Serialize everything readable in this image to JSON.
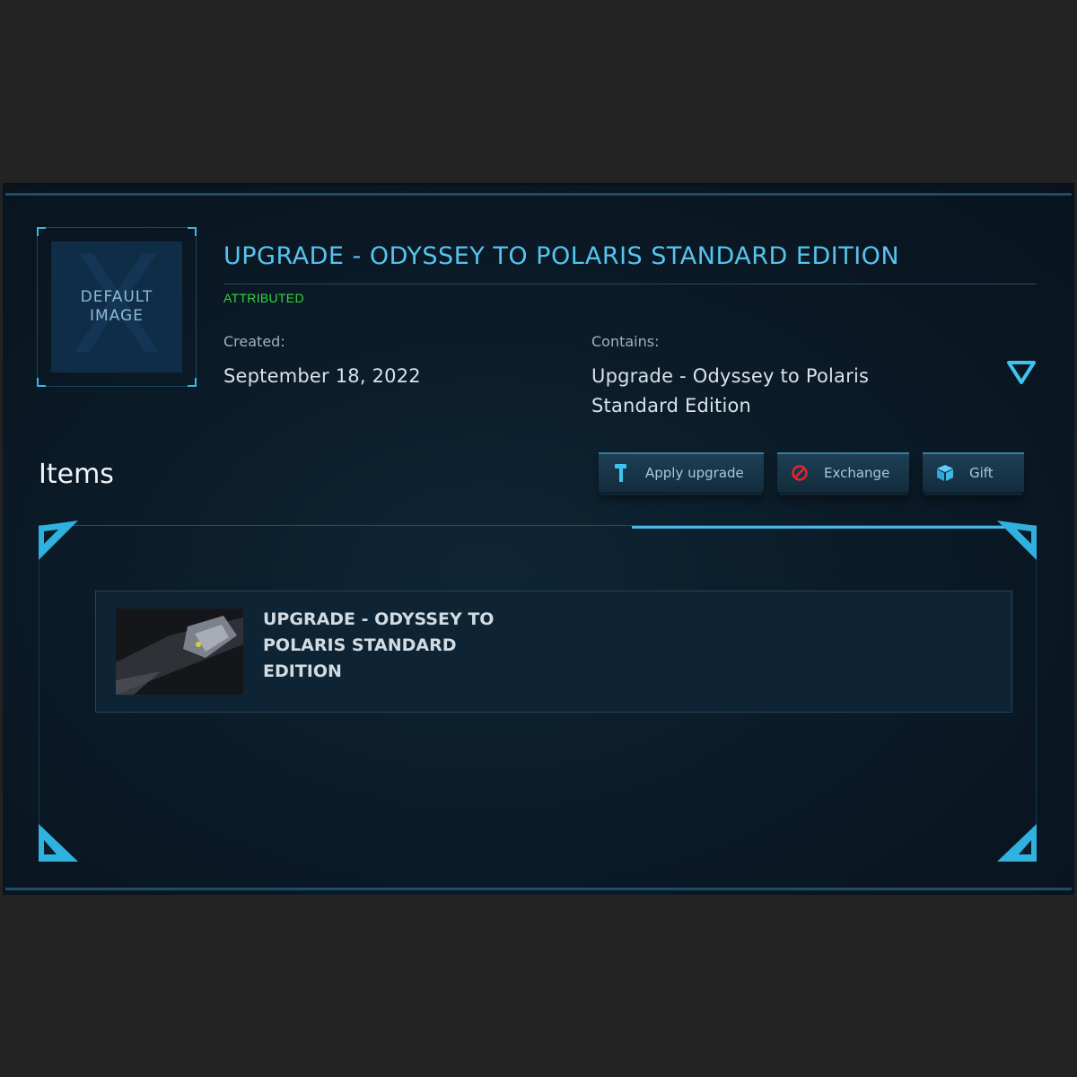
{
  "pledge": {
    "thumbnail_text": "DEFAULT IMAGE",
    "thumbnail_letter": "X",
    "title": "UPGRADE - ODYSSEY TO POLARIS STANDARD EDITION",
    "status": "ATTRIBUTED",
    "created_label": "Created:",
    "created_value": "September 18, 2022",
    "contains_label": "Contains:",
    "contains_value": "Upgrade - Odyssey to Polaris Standard Edition"
  },
  "items_section": {
    "heading": "Items",
    "buttons": {
      "apply_upgrade": "Apply upgrade",
      "exchange": "Exchange",
      "gift": "Gift"
    },
    "items": [
      {
        "name": "UPGRADE - ODYSSEY TO POLARIS STANDARD EDITION"
      }
    ]
  },
  "icons": [
    "expand-chevron-icon",
    "hammer-icon",
    "exchange-icon",
    "gift-icon"
  ],
  "colors": {
    "accent": "#56c4ee",
    "status_green": "#33d63c",
    "background": "#0b1b28",
    "exchange_red": "#e3262b"
  }
}
